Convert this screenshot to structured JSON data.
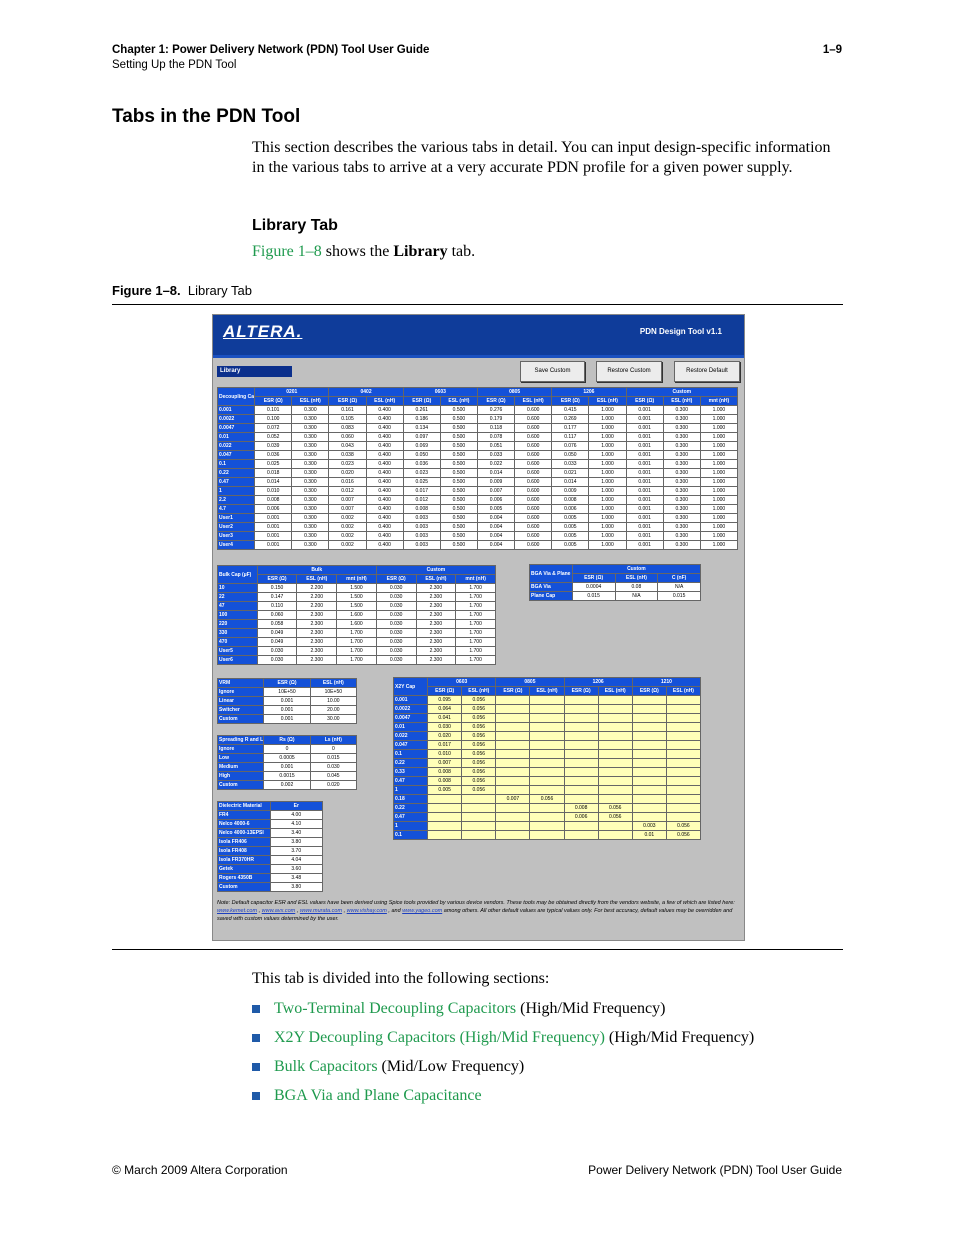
{
  "header": {
    "chapter": "Chapter 1:  Power Delivery Network (PDN) Tool User Guide",
    "page_number": "1–9",
    "section": "Setting Up the PDN Tool"
  },
  "title": "Tabs in the PDN Tool",
  "intro": "This section describes the various tabs in detail. You can input design-specific information in the various tabs to arrive at a very accurate PDN profile for a given power supply.",
  "library_heading": "Library Tab",
  "figure_ref": {
    "link": "Figure 1–8",
    "text1": " shows the ",
    "bold": "Library",
    "text2": " tab."
  },
  "figure_caption": {
    "label": "Figure 1–8.",
    "text": "Library Tab"
  },
  "screenshot": {
    "logo": "ALTERA.",
    "version": "PDN Design Tool v1.1",
    "tab": "Library",
    "buttons": [
      "Save Custom",
      "Restore Custom",
      "Restore Default"
    ],
    "decoupling": {
      "title": "Decoupling Cap (µF)",
      "groups": [
        "0201",
        "0402",
        "0603",
        "0805",
        "1206",
        "Custom"
      ],
      "subheads": [
        "ESR (Ω)",
        "ESL (nH)",
        "ESR (Ω)",
        "ESL (nH)",
        "ESR (Ω)",
        "ESL (nH)",
        "ESR (Ω)",
        "ESL (nH)",
        "ESR (Ω)",
        "ESL (nH)",
        "ESR (Ω)",
        "ESL (nH)",
        "mnt (nH)"
      ],
      "rows": [
        [
          "0.001",
          "0.101",
          "0.300",
          "0.161",
          "0.400",
          "0.261",
          "0.500",
          "0.276",
          "0.600",
          "0.415",
          "1.000",
          "0.001",
          "0.300",
          "1.000"
        ],
        [
          "0.0022",
          "0.100",
          "0.300",
          "0.105",
          "0.400",
          "0.186",
          "0.500",
          "0.179",
          "0.600",
          "0.269",
          "1.000",
          "0.001",
          "0.300",
          "1.000"
        ],
        [
          "0.0047",
          "0.072",
          "0.300",
          "0.083",
          "0.400",
          "0.134",
          "0.500",
          "0.118",
          "0.600",
          "0.177",
          "1.000",
          "0.001",
          "0.300",
          "1.000"
        ],
        [
          "0.01",
          "0.052",
          "0.300",
          "0.060",
          "0.400",
          "0.097",
          "0.500",
          "0.078",
          "0.600",
          "0.117",
          "1.000",
          "0.001",
          "0.300",
          "1.000"
        ],
        [
          "0.022",
          "0.039",
          "0.300",
          "0.043",
          "0.400",
          "0.069",
          "0.500",
          "0.051",
          "0.600",
          "0.076",
          "1.000",
          "0.001",
          "0.300",
          "1.000"
        ],
        [
          "0.047",
          "0.036",
          "0.300",
          "0.038",
          "0.400",
          "0.050",
          "0.500",
          "0.033",
          "0.600",
          "0.050",
          "1.000",
          "0.001",
          "0.300",
          "1.000"
        ],
        [
          "0.1",
          "0.025",
          "0.300",
          "0.023",
          "0.400",
          "0.036",
          "0.500",
          "0.022",
          "0.600",
          "0.033",
          "1.000",
          "0.001",
          "0.300",
          "1.000"
        ],
        [
          "0.22",
          "0.018",
          "0.300",
          "0.020",
          "0.400",
          "0.023",
          "0.500",
          "0.014",
          "0.600",
          "0.021",
          "1.000",
          "0.001",
          "0.300",
          "1.000"
        ],
        [
          "0.47",
          "0.014",
          "0.300",
          "0.016",
          "0.400",
          "0.025",
          "0.500",
          "0.009",
          "0.600",
          "0.014",
          "1.000",
          "0.001",
          "0.300",
          "1.000"
        ],
        [
          "1",
          "0.010",
          "0.300",
          "0.012",
          "0.400",
          "0.017",
          "0.500",
          "0.007",
          "0.600",
          "0.009",
          "1.000",
          "0.001",
          "0.300",
          "1.000"
        ],
        [
          "2.2",
          "0.008",
          "0.300",
          "0.007",
          "0.400",
          "0.012",
          "0.500",
          "0.006",
          "0.600",
          "0.008",
          "1.000",
          "0.001",
          "0.300",
          "1.000"
        ],
        [
          "4.7",
          "0.006",
          "0.300",
          "0.007",
          "0.400",
          "0.008",
          "0.500",
          "0.005",
          "0.600",
          "0.006",
          "1.000",
          "0.001",
          "0.300",
          "1.000"
        ],
        [
          "User1",
          "0.001",
          "0.300",
          "0.002",
          "0.400",
          "0.003",
          "0.500",
          "0.004",
          "0.600",
          "0.005",
          "1.000",
          "0.001",
          "0.300",
          "1.000"
        ],
        [
          "User2",
          "0.001",
          "0.300",
          "0.002",
          "0.400",
          "0.003",
          "0.500",
          "0.004",
          "0.600",
          "0.005",
          "1.000",
          "0.001",
          "0.300",
          "1.000"
        ],
        [
          "User3",
          "0.001",
          "0.300",
          "0.002",
          "0.400",
          "0.003",
          "0.500",
          "0.004",
          "0.600",
          "0.005",
          "1.000",
          "0.001",
          "0.300",
          "1.000"
        ],
        [
          "User4",
          "0.001",
          "0.300",
          "0.002",
          "0.400",
          "0.003",
          "0.500",
          "0.004",
          "0.600",
          "0.005",
          "1.000",
          "0.001",
          "0.300",
          "1.000"
        ]
      ]
    },
    "bulk": {
      "title": "Bulk Cap (µF)",
      "groups": [
        "Bulk",
        "Custom"
      ],
      "subheads": [
        "ESR (Ω)",
        "ESL (nH)",
        "mnt (nH)",
        "ESR (Ω)",
        "ESL (nH)",
        "mnt (nH)"
      ],
      "rows": [
        [
          "10",
          "0.150",
          "2.200",
          "1.500",
          "0.030",
          "2.300",
          "1.700"
        ],
        [
          "22",
          "0.147",
          "2.200",
          "1.500",
          "0.030",
          "2.300",
          "1.700"
        ],
        [
          "47",
          "0.110",
          "2.200",
          "1.500",
          "0.030",
          "2.300",
          "1.700"
        ],
        [
          "100",
          "0.060",
          "2.300",
          "1.600",
          "0.030",
          "2.300",
          "1.700"
        ],
        [
          "220",
          "0.058",
          "2.300",
          "1.600",
          "0.030",
          "2.300",
          "1.700"
        ],
        [
          "330",
          "0.049",
          "2.300",
          "1.700",
          "0.030",
          "2.300",
          "1.700"
        ],
        [
          "470",
          "0.049",
          "2.300",
          "1.700",
          "0.030",
          "2.300",
          "1.700"
        ],
        [
          "User5",
          "0.030",
          "2.300",
          "1.700",
          "0.030",
          "2.300",
          "1.700"
        ],
        [
          "User6",
          "0.030",
          "2.300",
          "1.700",
          "0.030",
          "2.300",
          "1.700"
        ]
      ]
    },
    "bga": {
      "title": "BGA Via & Plane Cap",
      "group": "Custom",
      "subheads": [
        "ESR (Ω)",
        "ESL (nH)",
        "C (nF)"
      ],
      "rows": [
        [
          "BGA Via",
          "0.0004",
          "0.08",
          "N/A"
        ],
        [
          "Plane Cap",
          "0.015",
          "N/A",
          "0.015"
        ]
      ]
    },
    "vrm": {
      "title": "VRM",
      "subheads": [
        "ESR (Ω)",
        "ESL (nH)"
      ],
      "rows": [
        [
          "Ignore",
          "10E+50",
          "10E+50"
        ],
        [
          "Linear",
          "0.001",
          "10.00"
        ],
        [
          "Switcher",
          "0.001",
          "20.00"
        ],
        [
          "Custom",
          "0.001",
          "30.00"
        ]
      ]
    },
    "spreading": {
      "title": "Spreading R and L",
      "subheads": [
        "Rs (Ω)",
        "Ls (nH)"
      ],
      "rows": [
        [
          "Ignore",
          "0",
          "0"
        ],
        [
          "Low",
          "0.0005",
          "0.015"
        ],
        [
          "Medium",
          "0.001",
          "0.030"
        ],
        [
          "High",
          "0.0015",
          "0.045"
        ],
        [
          "Custom",
          "0.002",
          "0.020"
        ]
      ]
    },
    "dielectric": {
      "title": "Dielectric Material",
      "subhead": "Er",
      "rows": [
        [
          "FR4",
          "4.00"
        ],
        [
          "Nelco 4000-6",
          "4.10"
        ],
        [
          "Nelco 4000-13EPSI",
          "3.40"
        ],
        [
          "Isola FR406",
          "3.80"
        ],
        [
          "Isola FR408",
          "3.70"
        ],
        [
          "Isola FR370HR",
          "4.04"
        ],
        [
          "Getek",
          "3.60"
        ],
        [
          "Rogers 4350B",
          "3.48"
        ],
        [
          "Custom",
          "3.80"
        ]
      ]
    },
    "x2y": {
      "title": "X2Y Cap",
      "groups": [
        "0603",
        "0805",
        "1206",
        "1210"
      ],
      "subheads": [
        "ESR (Ω)",
        "ESL (nH)",
        "ESR (Ω)",
        "ESL (nH)",
        "ESR (Ω)",
        "ESL (nH)",
        "ESR (Ω)",
        "ESL (nH)"
      ],
      "rows": [
        [
          "0.001",
          "0.095",
          "0.056",
          "",
          "",
          "",
          "",
          "",
          ""
        ],
        [
          "0.0022",
          "0.064",
          "0.056",
          "",
          "",
          "",
          "",
          "",
          ""
        ],
        [
          "0.0047",
          "0.041",
          "0.056",
          "",
          "",
          "",
          "",
          "",
          ""
        ],
        [
          "0.01",
          "0.030",
          "0.056",
          "",
          "",
          "",
          "",
          "",
          ""
        ],
        [
          "0.022",
          "0.020",
          "0.056",
          "",
          "",
          "",
          "",
          "",
          ""
        ],
        [
          "0.047",
          "0.017",
          "0.056",
          "",
          "",
          "",
          "",
          "",
          ""
        ],
        [
          "0.1",
          "0.010",
          "0.056",
          "",
          "",
          "",
          "",
          "",
          ""
        ],
        [
          "0.22",
          "0.007",
          "0.056",
          "",
          "",
          "",
          "",
          "",
          ""
        ],
        [
          "0.33",
          "0.008",
          "0.056",
          "",
          "",
          "",
          "",
          "",
          ""
        ],
        [
          "0.47",
          "0.008",
          "0.056",
          "",
          "",
          "",
          "",
          "",
          ""
        ],
        [
          "1",
          "0.005",
          "0.056",
          "",
          "",
          "",
          "",
          "",
          ""
        ],
        [
          "0.18",
          "",
          "",
          "0.007",
          "0.056",
          "",
          "",
          "",
          ""
        ],
        [
          "0.22",
          "",
          "",
          "",
          "",
          "0.008",
          "0.056",
          "",
          ""
        ],
        [
          "0.47",
          "",
          "",
          "",
          "",
          "0.006",
          "0.056",
          "",
          ""
        ],
        [
          "1",
          "",
          "",
          "",
          "",
          "",
          "",
          "0.003",
          "0.056"
        ],
        [
          "0.1",
          "",
          "",
          "",
          "",
          "",
          "",
          "0.01",
          "0.056"
        ]
      ]
    },
    "note": {
      "text1": "Note: Default capacitor ESR and ESL values have been derived using Spice tools provided by various device vendors. These tools may be obtained directly from the vendors website, a few of which are listed here: ",
      "link1": "www.kemet.com",
      "sep1": " , ",
      "link2": "www.avx.com",
      "sep2": " , ",
      "link3": "www.murata.com",
      "sep3": " , ",
      "link4": "www.vishay.com",
      "sep4": " , and ",
      "link5": "www.yageo.com",
      "text2": " among others. All other default values are typical values only. For best accuracy, default values may be overridden and saved with custom values determined by the user."
    }
  },
  "divided_text": "This tab is divided into the following sections:",
  "bullets": [
    {
      "link": "Two-Terminal Decoupling Capacitors",
      "suffix": " (High/Mid Frequency)"
    },
    {
      "link": "X2Y Decoupling Capacitors (High/Mid Frequency)",
      "suffix": " (High/Mid Frequency)"
    },
    {
      "link": "Bulk Capacitors",
      "suffix": " (Mid/Low Frequency)"
    },
    {
      "link": "BGA Via and Plane Capacitance",
      "suffix": ""
    }
  ],
  "footer": {
    "left": "© March 2009    Altera Corporation",
    "right": "Power Delivery Network (PDN) Tool User Guide"
  }
}
